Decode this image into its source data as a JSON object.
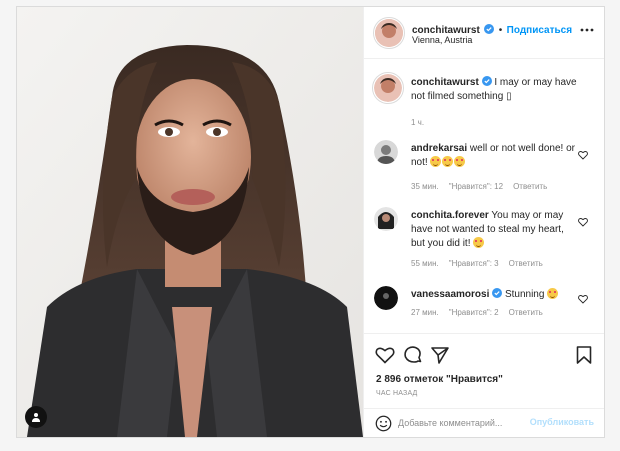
{
  "post": {
    "author": "conchitawurst",
    "follow_label": "Подписаться",
    "location": "Vienna, Austria",
    "caption_text": " I may or may have not filmed something ",
    "caption_glyph": "▯",
    "caption_time": "1 ч."
  },
  "comments": [
    {
      "user": "andrekarsai",
      "text": " well or not well done! or not! ",
      "time": "35 мин.",
      "likes": "\"Нравится\": 12",
      "reply": "Ответить",
      "emojis": 3
    },
    {
      "user": "conchita.forever",
      "text": " You may or may have not wanted to steal my heart, but you did it! ",
      "time": "55 мин.",
      "likes": "\"Нравится\": 3",
      "reply": "Ответить",
      "emojis": 1
    },
    {
      "user": "vanessaamorosi",
      "text": " Stunning ",
      "time": "27 мин.",
      "likes": "\"Нравится\": 2",
      "reply": "Ответить",
      "emojis": 1
    }
  ],
  "actions": {
    "likes_count": "2 896 отметок \"Нравится\"",
    "time_ago": "ЧАС НАЗАД",
    "comment_placeholder": "Добавьте комментарий...",
    "publish_label": "Опубликовать"
  },
  "icons": {
    "like": "heart-icon",
    "comment": "comment-icon",
    "share": "share-icon",
    "save": "bookmark-icon",
    "emoji": "emoji-icon",
    "more": "more-icon",
    "verified": "verified-badge-icon",
    "user_tag": "user-tag-icon"
  },
  "colors": {
    "accent": "#0095f6",
    "verified": "#3897f0",
    "muted": "#8e8e8e"
  }
}
